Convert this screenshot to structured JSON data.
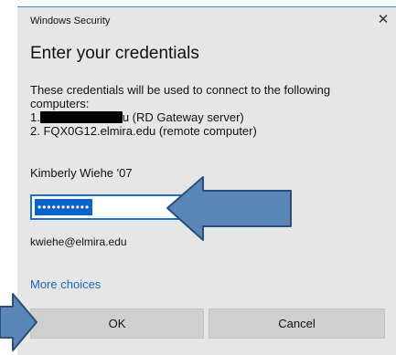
{
  "window": {
    "title": "Windows Security",
    "close_glyph": "✕"
  },
  "dialog": {
    "heading": "Enter your credentials",
    "description_line1": "These credentials will be used to connect to the following",
    "description_line2": "computers:",
    "item1_prefix": "1.",
    "item1_suffix": "u (RD Gateway server)",
    "item2": "2. FQX0G12.elmira.edu (remote computer)",
    "user_display_name": "Kimberly Wiehe '07",
    "password_value": "•••••••••••",
    "email": "kwiehe@elmira.edu",
    "more_choices": "More choices"
  },
  "buttons": {
    "ok": "OK",
    "cancel": "Cancel"
  },
  "colors": {
    "accent": "#1a73c9",
    "link": "#1a66c4",
    "annotation_arrow_fill": "#5b86b8",
    "annotation_arrow_stroke": "#2b4f7a"
  },
  "icons": {
    "close": "close-icon",
    "annotation": "arrow-annotation-icon"
  }
}
